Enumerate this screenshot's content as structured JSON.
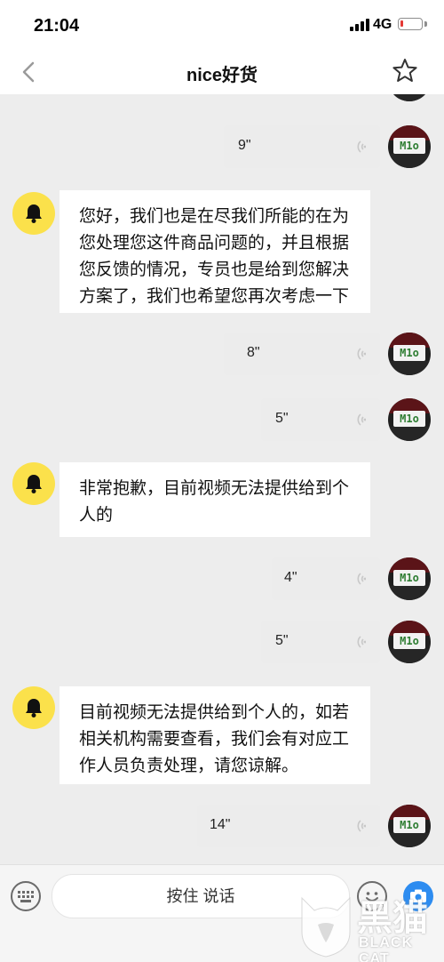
{
  "status_bar": {
    "time": "21:04",
    "network": "4G",
    "battery_level": 0.15,
    "battery_color": "#e53935"
  },
  "nav": {
    "back_icon": "chevron-left-icon",
    "title": "nice好货",
    "favorite_icon": "star-outline-icon"
  },
  "messages": [
    {
      "sender": "user",
      "type": "voice",
      "duration": "9\""
    },
    {
      "sender": "bot",
      "type": "text",
      "text": "您好，我们也是在尽我们所能的在为您处理您这件商品问题的，并且根据您反馈的情况，专员也是给到您解决方案了，我们也希望您再次考虑一下"
    },
    {
      "sender": "user",
      "type": "voice",
      "duration": "8\""
    },
    {
      "sender": "user",
      "type": "voice",
      "duration": "5\""
    },
    {
      "sender": "bot",
      "type": "text",
      "text": "非常抱歉，目前视频无法提供给到个人的"
    },
    {
      "sender": "user",
      "type": "voice",
      "duration": "4\""
    },
    {
      "sender": "user",
      "type": "voice",
      "duration": "5\""
    },
    {
      "sender": "bot",
      "type": "text",
      "text": "目前视频无法提供给到个人的，如若相关机构需要查看，我们会有对应工作人员负责处理，请您谅解。"
    },
    {
      "sender": "user",
      "type": "voice",
      "duration": "14\""
    }
  ],
  "user_avatar_plate": "M1o",
  "bot_avatar_icon": "bell-icon",
  "bot_avatar_color": "#fbe14b",
  "input_bar": {
    "keyboard_icon": "keyboard-icon",
    "hold_to_talk_label": "按住 说话",
    "emoji_icon": "smiley-icon",
    "camera_icon": "camera-icon",
    "camera_color": "#2d8cf0"
  },
  "watermark": {
    "cn": "黑猫",
    "en": "BLACK CAT"
  }
}
